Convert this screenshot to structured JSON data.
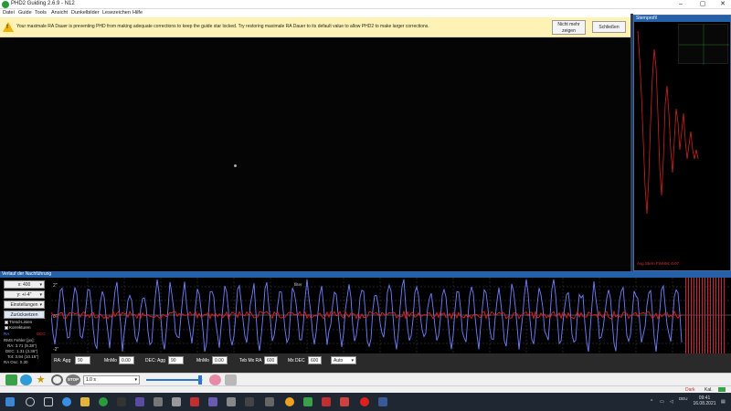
{
  "window": {
    "title": "PHD2 Guiding 2.6.9 - N12",
    "icon": "phd2-green-circle-icon"
  },
  "menu": {
    "items": [
      "Datei",
      "Guide",
      "Tools",
      "Ansicht",
      "Dunkelbilder",
      "Lesezeichen",
      "Hilfe"
    ]
  },
  "alert": {
    "message": "Your maximale RA Dauer is preventing PHD from making adequate corrections to keep the guide star locked. Try restoring maximale RA Dauer to its default value to allow PHD2 to make larger corrections.",
    "btn_show_line1": "Nicht mehr",
    "btn_show_line2": "zeigen",
    "btn_close": "Schließen"
  },
  "profile": {
    "title": "Sternprofil",
    "text": "Avg Stern FWHM: 0.07"
  },
  "history": {
    "title": "Verlauf der Nachführung",
    "x_btn": "x: 400",
    "y_btn": "y: +/-4\"",
    "settings_btn": "Einstellungen",
    "reset_btn": "Zurücksetzen",
    "trend_label": "Trend-Linien",
    "correction_label": "Korrekturen",
    "ra_label": "RA",
    "dec_label": "DEC",
    "rms_header": "RMS Fehler [px]:",
    "rms_ra": "RA: 3.71 (9.38\")",
    "rms_dec": "DEC: 1.31 (3.36\")",
    "rms_tot": "Tot: 3.94 (10.15\")",
    "ra_osc": "RA Osc: 0.30",
    "y_axis_top": "2\"",
    "y_axis_mid": "0\"",
    "y_axis_bot": "-2\"",
    "axis_marker": "filter"
  },
  "controls": {
    "ra_agg_label": "RA: Agg",
    "ra_agg": "90",
    "ra_minmo_label": "MnMo",
    "ra_minmo": "0.00",
    "dec_agg_label": "DEC: Agg",
    "dec_agg": "90",
    "dec_minmo_label": "MnMo",
    "dec_minmo": "0.00",
    "max_ra_label": "Teb Mx RA",
    "max_ra": "600",
    "max_dec_label": "Mx DEC",
    "max_dec": "600",
    "mode": "Auto"
  },
  "toolbar": {
    "exposure": "1.0 s",
    "stop": "STOP",
    "slider_value": 0.95
  },
  "statusbar": {
    "dark": "Dark",
    "cal": "Kal."
  },
  "taskbar": {
    "time": "09:41",
    "date": "16.08.2021"
  },
  "colors": {
    "ra": "#7080ff",
    "dec": "#e02020",
    "title_blue": "#2461a8",
    "alert_bg": "#fef3b4"
  },
  "chart_data": {
    "type": "line",
    "series": [
      {
        "name": "RA"
      },
      {
        "name": "DEC"
      }
    ],
    "ylabel_top": "2\"",
    "ylabel_bottom": "-2\""
  }
}
